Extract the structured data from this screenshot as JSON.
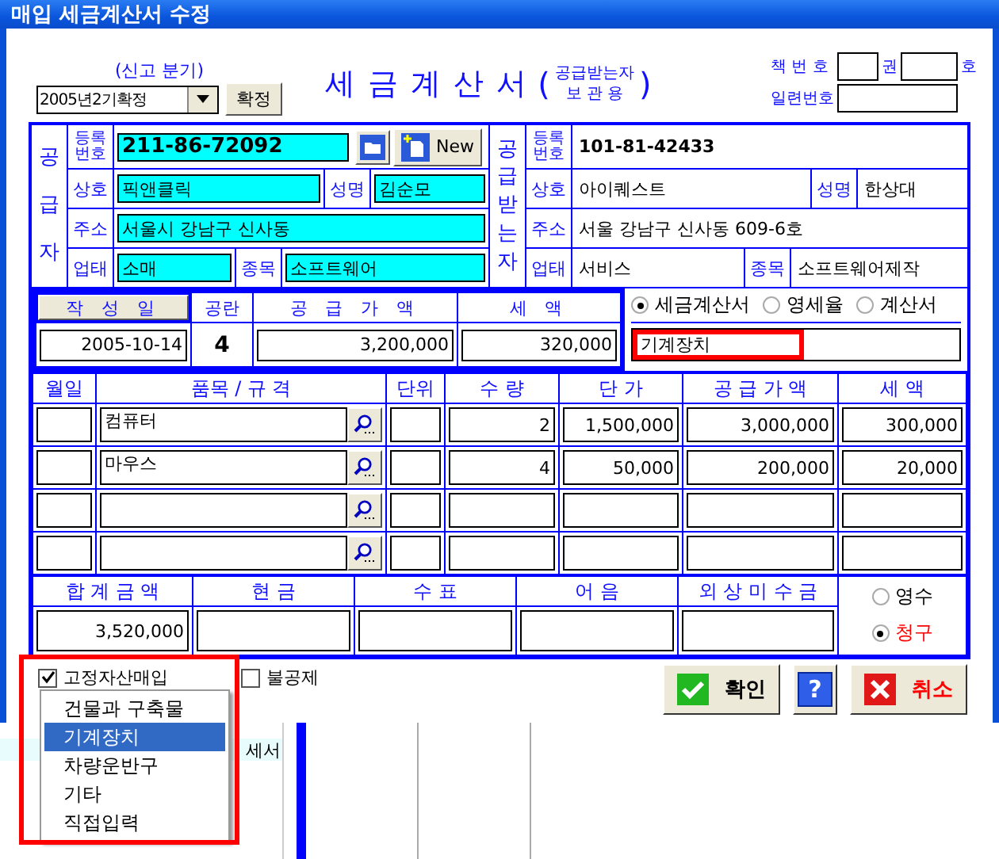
{
  "window": {
    "title": "매입 세금계산서 수정"
  },
  "period": {
    "label": "(신고 분기)",
    "value": "2005년2기확정",
    "button": "확정"
  },
  "heading": {
    "title": "세 금 계 산 서",
    "open_paren": "(",
    "note_line1": "공급받는자",
    "note_line2": "보 관 용",
    "close_paren": ")"
  },
  "book": {
    "book_label": "책 번 호",
    "volume_unit": "권",
    "number_unit": "호",
    "serial_label": "일련번호"
  },
  "supplier": {
    "side_label": "공급자",
    "reg_label": "등록번호",
    "reg_no": "211-86-72092",
    "new_button": "New",
    "name_label": "상호",
    "name": "픽앤클릭",
    "rep_label": "성명",
    "rep": "김순모",
    "addr_label": "주소",
    "addr": "서울시 강남구 신사동",
    "biz_label": "업태",
    "biz": "소매",
    "item_label": "종목",
    "item": "소프트웨어"
  },
  "receiver": {
    "side_label": "공급받는자",
    "reg_label": "등록번호",
    "reg_no": "101-81-42433",
    "name_label": "상호",
    "name": "아이퀘스트",
    "rep_label": "성명",
    "rep": "한상대",
    "addr_label": "주소",
    "addr": "서울 강남구 신사동 609-6호",
    "biz_label": "업태",
    "biz": "서비스",
    "item_label": "종목",
    "item": "소프트웨어제작"
  },
  "summary": {
    "date_button": "작 성 일",
    "blank_label": "공란",
    "supply_label": "공 급 가 액",
    "tax_label": "세 액",
    "date": "2005-10-14",
    "blanks": "4",
    "supply": "3,200,000",
    "tax": "320,000"
  },
  "doc_types": [
    {
      "label": "세금계산서",
      "selected": true
    },
    {
      "label": "영세율",
      "selected": false
    },
    {
      "label": "계산서",
      "selected": false
    }
  ],
  "memo": {
    "value": "기계장치",
    "highlighted": true
  },
  "items": {
    "columns": [
      "월일",
      "품목 / 규 격",
      "단위",
      "수 량",
      "단 가",
      "공 급 가 액",
      "세 액"
    ],
    "rows": [
      {
        "name": "컴퓨터",
        "qty": "2",
        "price": "1,500,000",
        "supply": "3,000,000",
        "tax": "300,000"
      },
      {
        "name": "마우스",
        "qty": "4",
        "price": "50,000",
        "supply": "200,000",
        "tax": "20,000"
      },
      {},
      {}
    ]
  },
  "totals": {
    "columns": [
      "합 계 금 액",
      "현 금",
      "수 표",
      "어 음",
      "외 상 미 수 금"
    ],
    "total": "3,520,000"
  },
  "receipt": [
    {
      "label": "영수",
      "selected": false
    },
    {
      "label": "청구",
      "selected": true
    }
  ],
  "options": {
    "highlighted": true,
    "checkboxes": [
      {
        "label": "고정자산매입",
        "checked": true
      },
      {
        "label": "불공제",
        "checked": false
      }
    ]
  },
  "buttons": [
    {
      "kind": "ok",
      "label": "확인"
    },
    {
      "kind": "help",
      "label": "?"
    },
    {
      "kind": "cancel",
      "label": "취소"
    }
  ],
  "asset_menu": [
    {
      "label": "건물과 구축물",
      "selected": false
    },
    {
      "label": "기계장치",
      "selected": true
    },
    {
      "label": "차량운반구",
      "selected": false
    },
    {
      "label": "기타",
      "selected": false
    },
    {
      "label": "직접입력",
      "selected": false
    }
  ],
  "background": {
    "fragment": "세서"
  }
}
